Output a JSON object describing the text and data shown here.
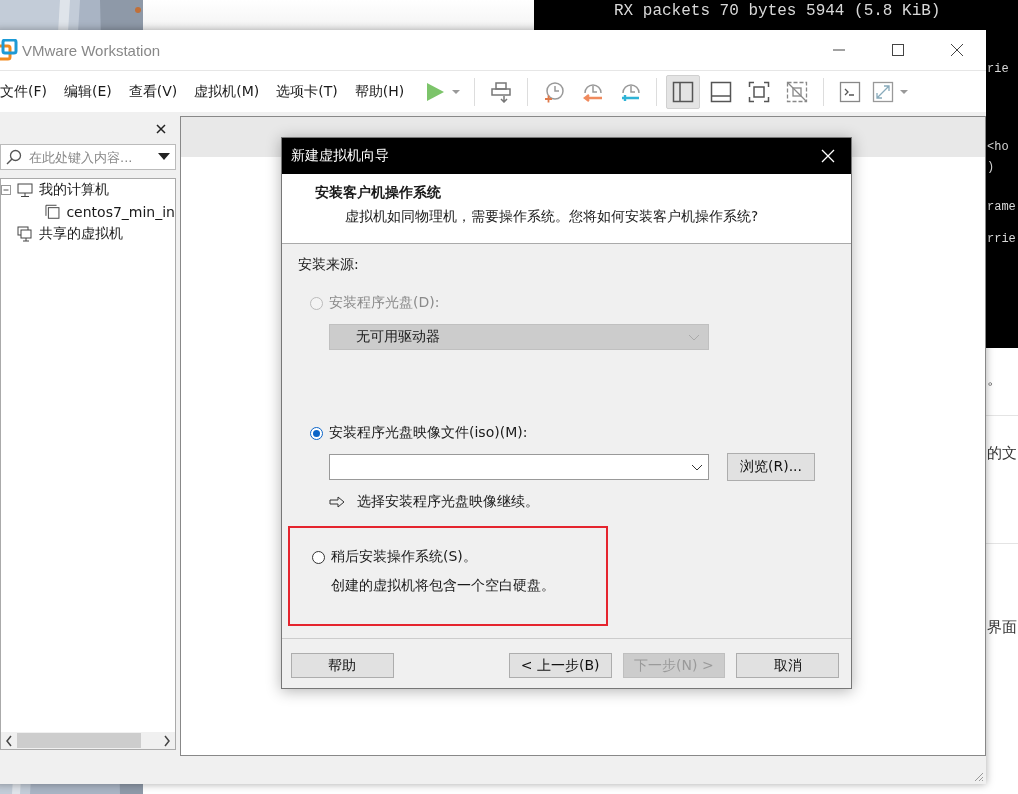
{
  "background": {
    "terminal": {
      "lines": [
        "RX packets 70  bytes 5944 (5.8 KiB)"
      ],
      "fragments": [
        "rie",
        "<ho",
        ")",
        "rame",
        "rrie"
      ]
    },
    "document_right": {
      "fragments": [
        "。",
        "的文",
        "界面"
      ]
    }
  },
  "window": {
    "title": "VMware Workstation",
    "menu": [
      "文件(F)",
      "编辑(E)",
      "查看(V)",
      "虚拟机(M)",
      "选项卡(T)",
      "帮助(H)"
    ],
    "toolbar": [
      {
        "kind": "play",
        "selected": false
      },
      {
        "kind": "separator"
      },
      {
        "kind": "send-keys",
        "selected": false
      },
      {
        "kind": "separator"
      },
      {
        "kind": "snapshot-take",
        "selected": false
      },
      {
        "kind": "snapshot-revert",
        "selected": false
      },
      {
        "kind": "snapshot-manage",
        "selected": false
      },
      {
        "kind": "separator"
      },
      {
        "kind": "view-library",
        "selected": true
      },
      {
        "kind": "view-thumbnail",
        "selected": false
      },
      {
        "kind": "fullscreen",
        "selected": false
      },
      {
        "kind": "unity",
        "selected": false
      },
      {
        "kind": "separator"
      },
      {
        "kind": "console",
        "selected": false
      },
      {
        "kind": "stretch",
        "selected": false
      }
    ],
    "library": {
      "search": {
        "placeholder": "在此处键入内容..."
      },
      "tree": [
        {
          "label": "我的计算机",
          "kind": "computer",
          "expanded": true,
          "children": [
            {
              "label": "centos7_min_in",
              "kind": "vm"
            }
          ]
        },
        {
          "label": "共享的虚拟机",
          "kind": "shared"
        }
      ]
    }
  },
  "dialog": {
    "title": "新建虚拟机向导",
    "heading": "安装客户机操作系统",
    "subheading": "虚拟机如同物理机，需要操作系统。您将如何安装客户机操作系统?",
    "section_label": "安装来源:",
    "options": [
      {
        "kind": "disc",
        "label": "安装程序光盘(D):",
        "selected": false,
        "disabled": true,
        "select_value": "无可用驱动器"
      },
      {
        "kind": "iso",
        "label": "安装程序光盘映像文件(iso)(M):",
        "selected": true,
        "disabled": false,
        "browse_button": "浏览(R)...",
        "hint": "选择安装程序光盘映像继续。"
      },
      {
        "kind": "later",
        "label": "稍后安装操作系统(S)。",
        "selected": false,
        "disabled": false,
        "highlighted": true,
        "note": "创建的虚拟机将包含一个空白硬盘。"
      }
    ],
    "buttons": [
      {
        "label": "帮助",
        "disabled": false
      },
      {
        "label": "< 上一步(B)",
        "disabled": false
      },
      {
        "label": "下一步(N) >",
        "disabled": true
      },
      {
        "label": "取消",
        "disabled": false
      }
    ]
  }
}
